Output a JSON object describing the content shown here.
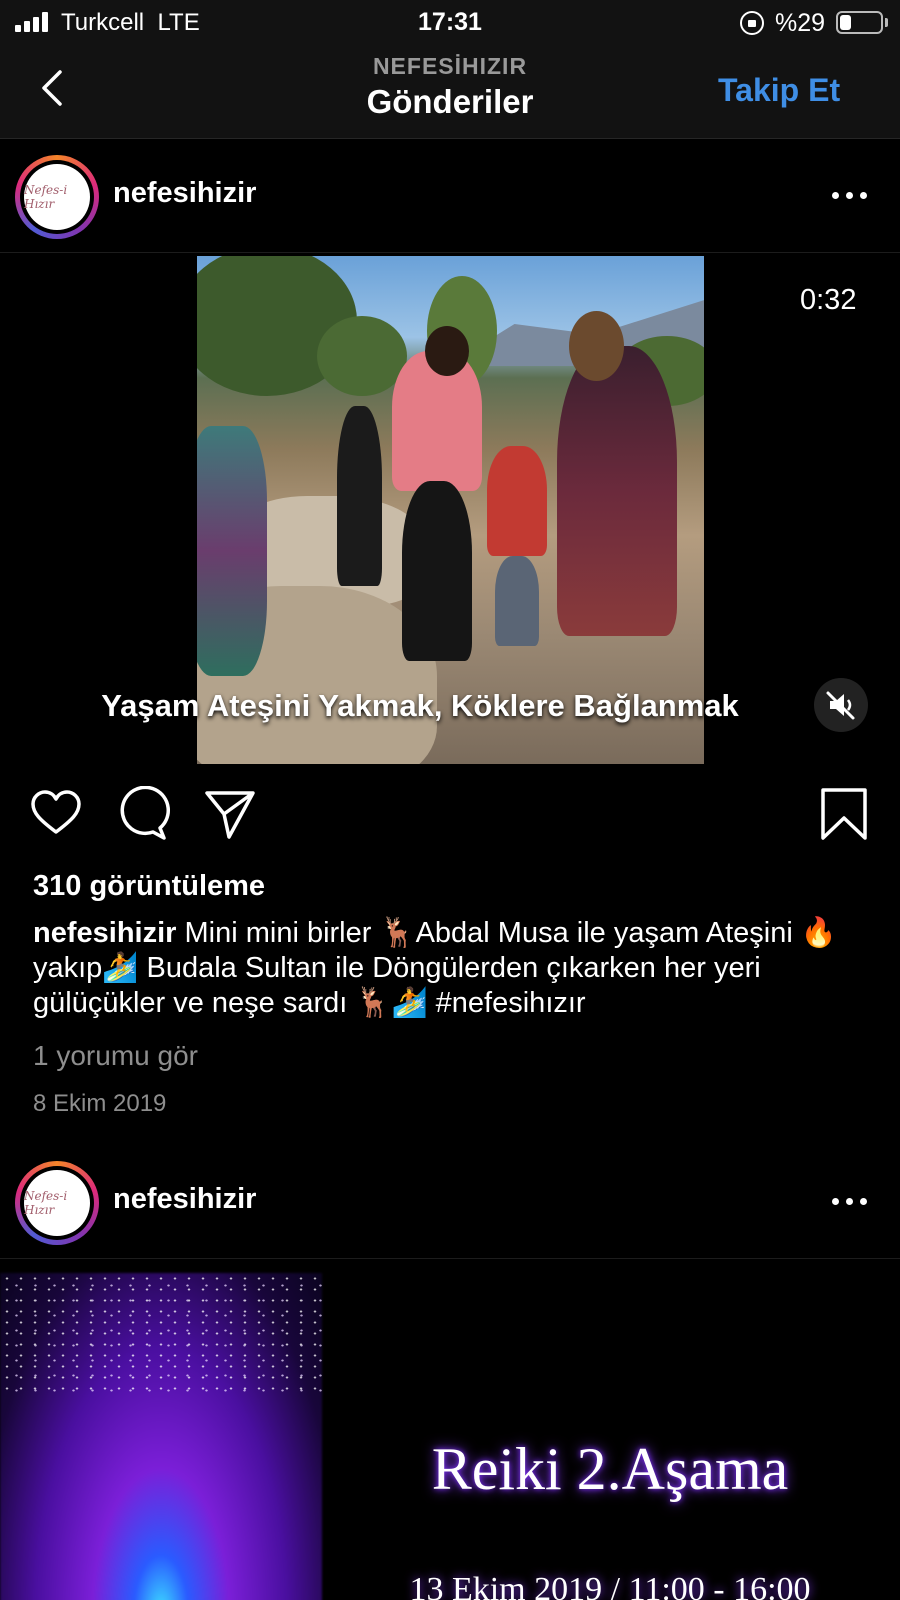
{
  "status_bar": {
    "carrier": "Turkcell",
    "network": "LTE",
    "time": "17:31",
    "battery_text": "%29",
    "battery_level": 0.29,
    "icons": [
      "signal-icon",
      "orientation-lock-icon",
      "battery-icon"
    ]
  },
  "header": {
    "account": "NEFESİHIZIR",
    "title": "Gönderiler",
    "follow_label": "Takip Et",
    "follow_color": "#3f8ee5",
    "back_icon": "chevron-left-icon"
  },
  "post1": {
    "username": "nefesihizir",
    "avatar_text": "Nefes-i Hızır",
    "video": {
      "duration": "0:32",
      "overlay_text": "Yaşam Ateşini Yakmak, Köklere Bağlanmak",
      "muted": true
    },
    "actions": [
      "heart-icon",
      "comment-icon",
      "share-icon",
      "bookmark-icon"
    ],
    "views": "310 görüntüleme",
    "caption_user": "nefesihizir",
    "caption_text": "Mini mini birler 🦌Abdal Musa ile yaşam Ateşini 🔥 yakıp🏄 Budala Sultan ile Döngülerden çıkarken her yeri gülüçükler ve neşe sardı 🦌🏄 #nefesihızır",
    "comments_link": "1 yorumu gör",
    "date": "8 Ekim 2019"
  },
  "post2": {
    "username": "nefesihizir",
    "avatar_text": "Nefes-i Hızır",
    "image_title": "Reiki 2.Aşama",
    "image_date": "13 Ekim 2019 / 11:00 - 16:00"
  }
}
